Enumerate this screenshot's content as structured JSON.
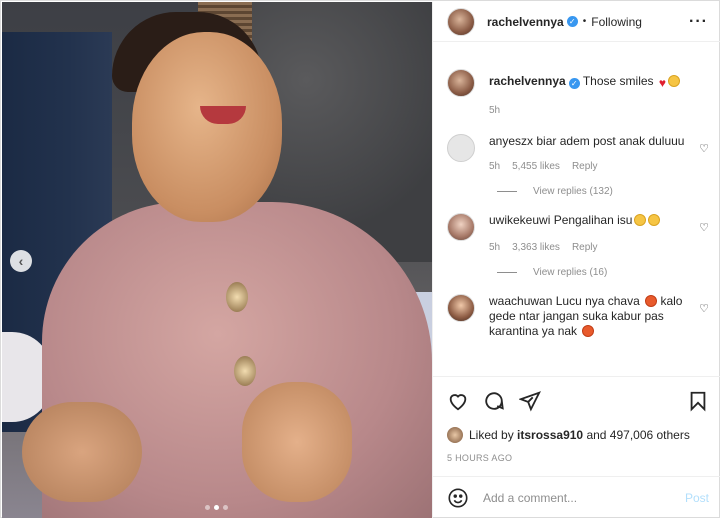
{
  "post": {
    "username": "rachelvennya",
    "follow_status": "Following",
    "caption": "Those smiles",
    "caption_time": "5h",
    "likes_user": "itsrossa910",
    "likes_prefix": "Liked by",
    "likes_suffix": "and 497,006 others",
    "posted_time": "5 HOURS AGO",
    "carousel_dots": 3,
    "carousel_active": 2
  },
  "comments": [
    {
      "username": "anyeszx",
      "text": "biar adem post anak duluuu",
      "time": "5h",
      "likes": "5,455 likes",
      "reply": "Reply",
      "view_replies": "View replies (132)"
    },
    {
      "username": "uwikekeuwi",
      "text": "Pengalihan isu",
      "time": "5h",
      "likes": "3,363 likes",
      "reply": "Reply",
      "view_replies": "View replies (16)"
    },
    {
      "username": "waachuwan",
      "text": "Lucu nya chava",
      "text2": "kalo gede ntar jangan suka kabur pas karantina ya nak",
      "time": "",
      "likes": "",
      "reply": ""
    }
  ],
  "composer": {
    "placeholder": "Add a comment...",
    "post_label": "Post"
  },
  "icons": {
    "more": "more-options-icon",
    "like": "heart-icon",
    "comment": "comment-icon",
    "share": "share-icon",
    "save": "bookmark-icon",
    "emoji": "emoji-icon",
    "prev": "chevron-left-icon"
  },
  "colors": {
    "verified": "#3897f0",
    "muted": "#8e8e8e",
    "post_disabled": "#b2dffc"
  }
}
